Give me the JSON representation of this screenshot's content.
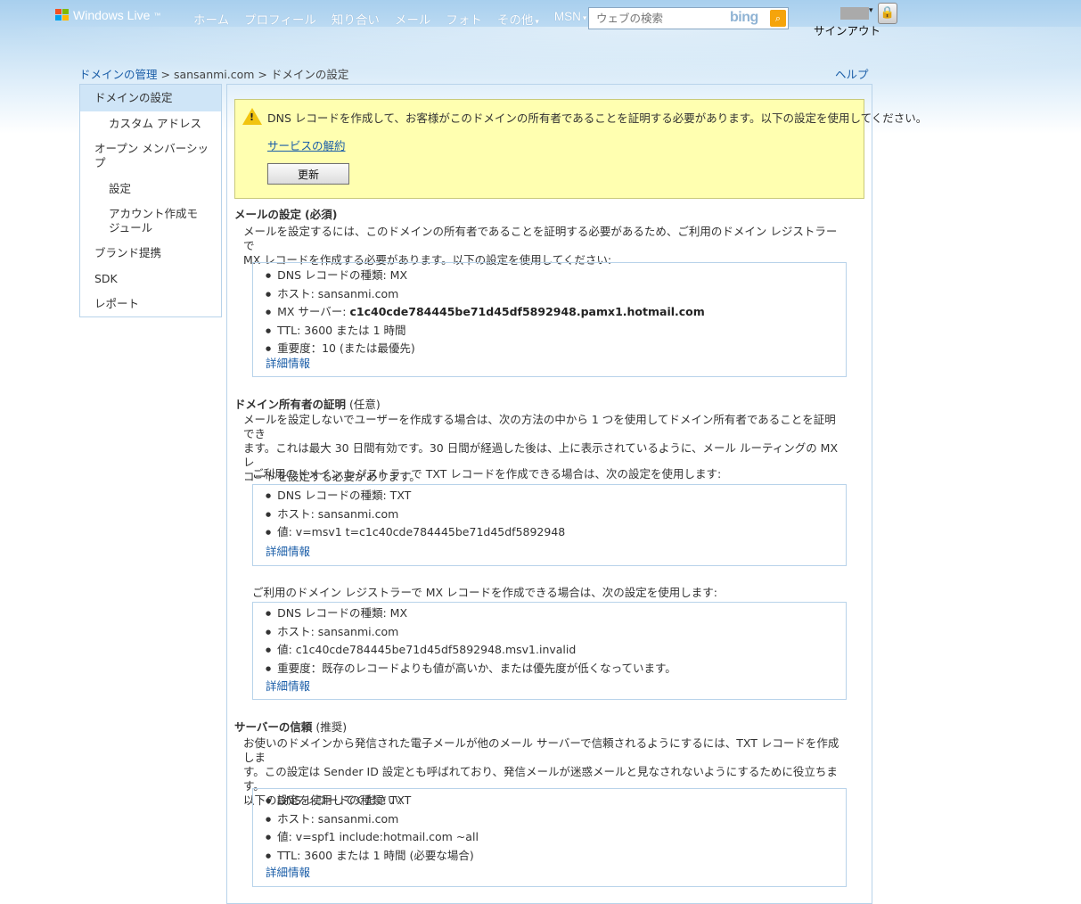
{
  "header": {
    "logo": "Windows Live",
    "logo_tm": "™",
    "nav": [
      {
        "label": "ホーム"
      },
      {
        "label": "プロフィール"
      },
      {
        "label": "知り合い"
      },
      {
        "label": "メール"
      },
      {
        "label": "フォト"
      },
      {
        "label": "その他"
      },
      {
        "label": "MSN"
      }
    ],
    "search_placeholder": "ウェブの検索",
    "search_brand": "bing",
    "signout": "サインアウト"
  },
  "breadcrumb": {
    "root": "ドメインの管理",
    "sep1": " > ",
    "domain": "sansanmi.com",
    "sep2": " > ",
    "current": "ドメインの設定"
  },
  "help": "ヘルプ",
  "sidebar": {
    "items": [
      {
        "label": "ドメインの設定"
      },
      {
        "label": "カスタム アドレス"
      },
      {
        "label": "オープン メンバーシップ"
      },
      {
        "label": "設定"
      },
      {
        "label": "アカウント作成モジュール"
      },
      {
        "label": "ブランド提携"
      },
      {
        "label": "SDK"
      },
      {
        "label": "レポート"
      }
    ]
  },
  "warning": {
    "message": "DNS レコードを作成して、お客様がこのドメインの所有者であることを証明する必要があります。以下の設定を使用してください。",
    "cancel_link": "サービスの解約",
    "refresh_button": "更新"
  },
  "mail": {
    "title": "メールの設定",
    "tag": "(必須)",
    "desc1": "メールを設定するには、このドメインの所有者であることを証明する必要があるため、ご利用のドメイン レジストラーで",
    "desc2": "MX レコードを作成する必要があります。以下の設定を使用してください:",
    "items": [
      {
        "label": "DNS レコードの種類: MX",
        "value": ""
      },
      {
        "label": "ホスト: sansanmi.com",
        "value": ""
      },
      {
        "label": "MX サーバー: ",
        "value": "c1c40cde784445be71d45df5892948.pamx1.hotmail.com"
      },
      {
        "label": "TTL: 3600 または 1 時間",
        "value": ""
      },
      {
        "label": "重要度：10 (または最優先)",
        "value": ""
      }
    ],
    "more": "詳細情報"
  },
  "owner": {
    "title": "ドメイン所有者の証明",
    "tag": "(任意)",
    "desc1": "メールを設定しないでユーザーを作成する場合は、次の方法の中から 1 つを使用してドメイン所有者であることを証明でき",
    "desc2": "ます。これは最大 30 日間有効です。30 日間が経過した後は、上に表示されているように、メール ルーティングの MX レ",
    "desc3": "コードを設定する必要があります。",
    "txt_intro": "ご利用のドメイン レジストラーで TXT レコードを作成できる場合は、次の設定を使用します:",
    "txt_items": [
      {
        "label": "DNS レコードの種類: TXT"
      },
      {
        "label": "ホスト: sansanmi.com"
      },
      {
        "label": "値: v=msv1 t=c1c40cde784445be71d45df5892948"
      }
    ],
    "txt_more": "詳細情報",
    "mx_intro": "ご利用のドメイン レジストラーで MX レコードを作成できる場合は、次の設定を使用します:",
    "mx_items": [
      {
        "label": "DNS レコードの種類: MX"
      },
      {
        "label": "ホスト: sansanmi.com"
      },
      {
        "label": "値: c1c40cde784445be71d45df5892948.msv1.invalid"
      },
      {
        "label": "重要度：既存のレコードよりも値が高いか、または優先度が低くなっています。"
      }
    ],
    "mx_more": "詳細情報"
  },
  "trust": {
    "title": "サーバーの信頼",
    "tag": "(推奨)",
    "desc1": "お使いのドメインから発信された電子メールが他のメール サーバーで信頼されるようにするには、TXT レコードを作成しま",
    "desc2": "す。この設定は Sender ID 設定とも呼ばれており、発信メールが迷惑メールと見なされないようにするために役立ちます。",
    "desc3": "以下の設定を使用してください:",
    "items": [
      {
        "label": "DNS レコードの種類: TXT"
      },
      {
        "label": "ホスト: sansanmi.com"
      },
      {
        "label": "値: v=spf1 include:hotmail.com ~all"
      },
      {
        "label": "TTL: 3600 または 1 時間 (必要な場合)"
      }
    ],
    "more": "詳細情報"
  }
}
